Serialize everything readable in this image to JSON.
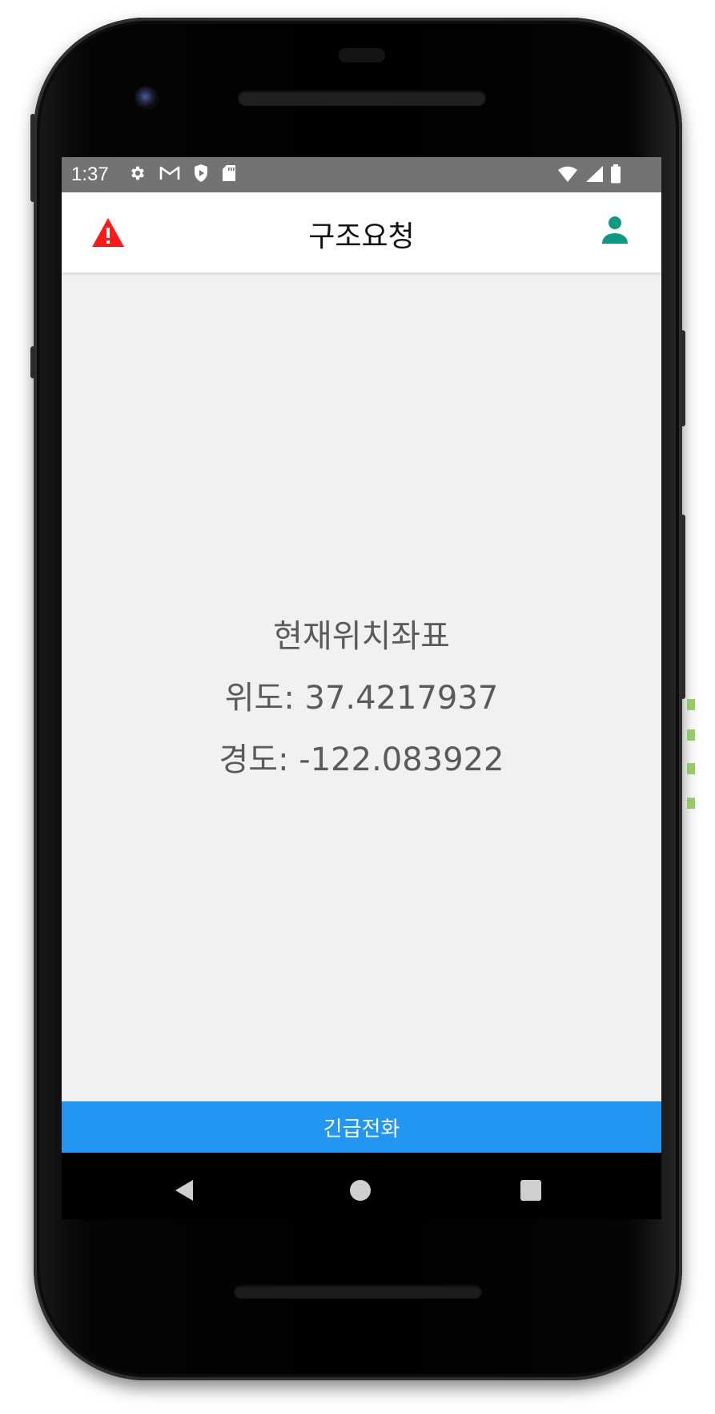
{
  "status_bar": {
    "time": "1:37",
    "left_icons": [
      "gear-icon",
      "gmail-icon",
      "play-protect-icon",
      "sd-card-icon"
    ],
    "right_icons": [
      "wifi-icon",
      "signal-icon",
      "battery-icon"
    ]
  },
  "app_bar": {
    "title": "구조요청",
    "left_icon": "warning-icon",
    "right_icon": "user-icon"
  },
  "content": {
    "heading": "현재위치좌표",
    "latitude_line": "위도: 37.4217937",
    "longitude_line": "경도: -122.083922"
  },
  "emergency_button": {
    "label": "긴급전화"
  },
  "nav_bar": {
    "icons": [
      "back-icon",
      "home-icon",
      "recents-icon"
    ]
  },
  "colors": {
    "accent_button": "#2196f3",
    "warning_icon": "#ff1a1a",
    "user_icon": "#0e9886",
    "status_bar": "#737373",
    "content_background": "#f1f1f1"
  }
}
